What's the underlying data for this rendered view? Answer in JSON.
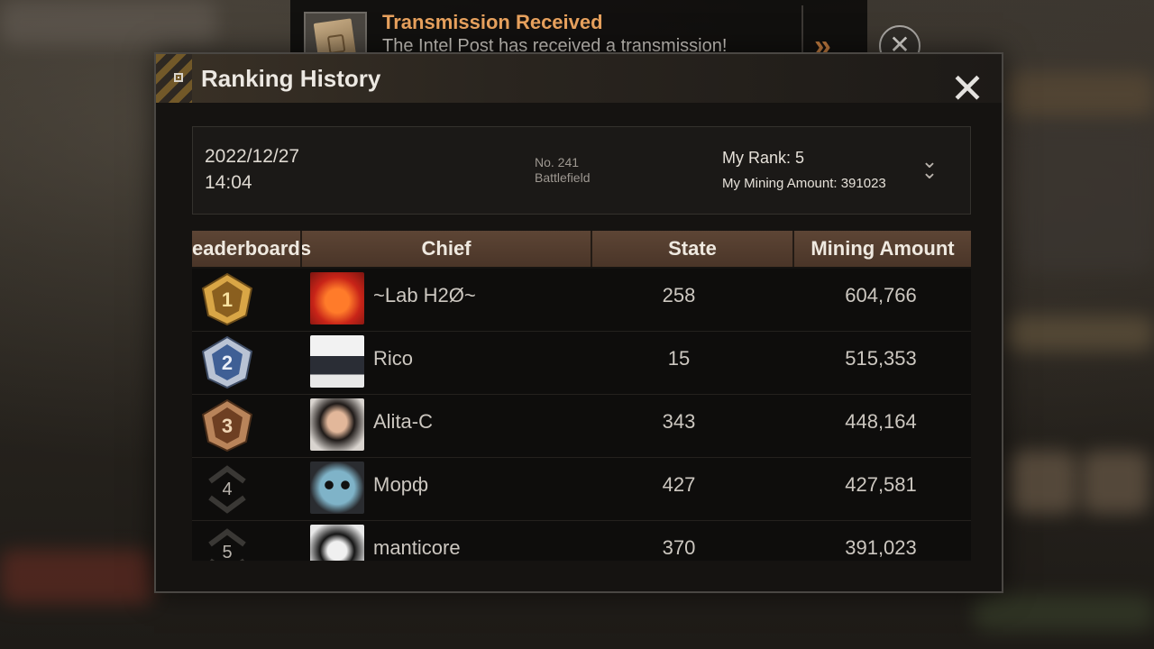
{
  "notification": {
    "title": "Transmission Received",
    "text": "The Intel Post has received a transmission!",
    "arrow": "»",
    "close": "✕",
    "icon": "document-icon"
  },
  "panel": {
    "title": "Ranking History",
    "close": "✕"
  },
  "info": {
    "date": "2022/12/27",
    "time": "14:04",
    "season_number": "No. 241",
    "season_name": "Battlefield",
    "my_rank": "My Rank: 5",
    "my_mining": "My Mining Amount: 391023",
    "expand_icon": "double-chevron-down-icon"
  },
  "table": {
    "headers": {
      "leaderboards": "eaderboards",
      "chief": "Chief",
      "state": "State",
      "mining": "Mining Amount"
    },
    "rows": [
      {
        "rank": "1",
        "name": "~Lab H2Ø~",
        "state": "258",
        "mining": "604,766",
        "avatar_color": "#d6391c"
      },
      {
        "rank": "2",
        "name": "Rico",
        "state": "15",
        "mining": "515,353",
        "avatar_color": "#d9d9d9"
      },
      {
        "rank": "3",
        "name": "Alita-C",
        "state": "343",
        "mining": "448,164",
        "avatar_color": "#8a7868"
      },
      {
        "rank": "4",
        "name": "Морф",
        "state": "427",
        "mining": "427,581",
        "avatar_color": "#7fb3c8"
      },
      {
        "rank": "5",
        "name": "manticore",
        "state": "370",
        "mining": "391,023",
        "avatar_color": "#e9e9e9"
      }
    ]
  },
  "colors": {
    "gold": "#d9a646",
    "silver": "#6f8fc0",
    "bronze": "#a8643a",
    "accent_orange": "#e8a25e",
    "header_brown": "#5d4535"
  }
}
